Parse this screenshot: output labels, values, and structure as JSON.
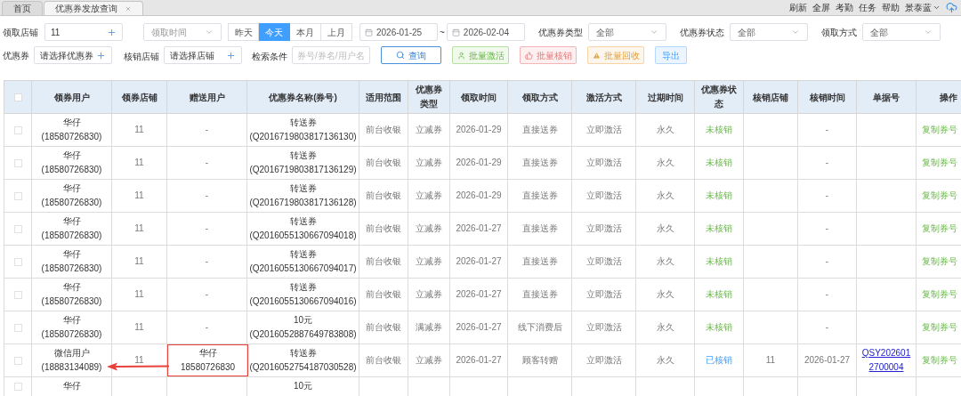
{
  "tabs": [
    {
      "label": "首页",
      "selected": false,
      "closable": false
    },
    {
      "label": "优惠券发放查询",
      "selected": true,
      "closable": true
    }
  ],
  "top_links": [
    "刷新",
    "全屏",
    "考勤",
    "任务",
    "帮助"
  ],
  "user_menu": "景泰蓝",
  "filters": {
    "store": {
      "label": "领取店铺",
      "value": "11"
    },
    "time_select": {
      "placeholder": "领取时间"
    },
    "quick_dates": [
      {
        "label": "昨天",
        "selected": false
      },
      {
        "label": "今天",
        "selected": true
      },
      {
        "label": "本月",
        "selected": false
      },
      {
        "label": "上月",
        "selected": false
      }
    ],
    "date_from": "2026-01-25",
    "date_sep": "~",
    "date_to": "2026-02-04",
    "selects": [
      {
        "label": "优惠券类型",
        "value": "全部"
      },
      {
        "label": "优惠券状态",
        "value": "全部"
      },
      {
        "label": "领取方式",
        "value": "全部"
      }
    ],
    "coupon": {
      "label": "优惠券",
      "placeholder": "请选择优惠券"
    },
    "verify_store": {
      "label": "核销店铺",
      "placeholder": "请选择店铺"
    },
    "search": {
      "label": "检索条件",
      "placeholder": "券号/券名/用户名"
    },
    "buttons": [
      {
        "label": "查询",
        "kind": "search"
      },
      {
        "label": "批量激活",
        "kind": "activate"
      },
      {
        "label": "批量核销",
        "kind": "verify"
      },
      {
        "label": "批量回收",
        "kind": "recycle"
      },
      {
        "label": "导出",
        "kind": "export"
      }
    ]
  },
  "table": {
    "all_checked": false,
    "columns": [
      "领券用户",
      "领券店铺",
      "赠送用户",
      "优惠券名称(券号)",
      "适用范围",
      "优惠券类型",
      "领取时间",
      "领取方式",
      "激活方式",
      "过期时间",
      "优惠券状态",
      "核销店铺",
      "核销时间",
      "单据号",
      "操作"
    ],
    "rows": [
      {
        "checked": false,
        "user": "华仔\n(18580726830)",
        "store": "11",
        "gift_user": "-",
        "gift_highlighted": false,
        "coupon": "转送券\n(Q2016719803817136130)",
        "scope": "前台收银",
        "type": "立减券",
        "time": "2026-01-29",
        "method": "直接送券",
        "activation": "立即激活",
        "expire": "永久",
        "status": "未核销",
        "verified": false,
        "verify_store": "",
        "verify_time": "-",
        "receipt": "",
        "action": "复制券号"
      },
      {
        "checked": false,
        "user": "华仔\n(18580726830)",
        "store": "11",
        "gift_user": "-",
        "gift_highlighted": false,
        "coupon": "转送券\n(Q2016719803817136129)",
        "scope": "前台收银",
        "type": "立减券",
        "time": "2026-01-29",
        "method": "直接送券",
        "activation": "立即激活",
        "expire": "永久",
        "status": "未核销",
        "verified": false,
        "verify_store": "",
        "verify_time": "-",
        "receipt": "",
        "action": "复制券号"
      },
      {
        "checked": false,
        "user": "华仔\n(18580726830)",
        "store": "11",
        "gift_user": "-",
        "gift_highlighted": false,
        "coupon": "转送券\n(Q2016719803817136128)",
        "scope": "前台收银",
        "type": "立减券",
        "time": "2026-01-29",
        "method": "直接送券",
        "activation": "立即激活",
        "expire": "永久",
        "status": "未核销",
        "verified": false,
        "verify_store": "",
        "verify_time": "-",
        "receipt": "",
        "action": "复制券号"
      },
      {
        "checked": false,
        "user": "华仔\n(18580726830)",
        "store": "11",
        "gift_user": "-",
        "gift_highlighted": false,
        "coupon": "转送券\n(Q2016055130667094018)",
        "scope": "前台收银",
        "type": "立减券",
        "time": "2026-01-27",
        "method": "直接送券",
        "activation": "立即激活",
        "expire": "永久",
        "status": "未核销",
        "verified": false,
        "verify_store": "",
        "verify_time": "-",
        "receipt": "",
        "action": "复制券号"
      },
      {
        "checked": false,
        "user": "华仔\n(18580726830)",
        "store": "11",
        "gift_user": "-",
        "gift_highlighted": false,
        "coupon": "转送券\n(Q2016055130667094017)",
        "scope": "前台收银",
        "type": "立减券",
        "time": "2026-01-27",
        "method": "直接送券",
        "activation": "立即激活",
        "expire": "永久",
        "status": "未核销",
        "verified": false,
        "verify_store": "",
        "verify_time": "-",
        "receipt": "",
        "action": "复制券号"
      },
      {
        "checked": false,
        "user": "华仔\n(18580726830)",
        "store": "11",
        "gift_user": "-",
        "gift_highlighted": false,
        "coupon": "转送券\n(Q2016055130667094016)",
        "scope": "前台收银",
        "type": "立减券",
        "time": "2026-01-27",
        "method": "直接送券",
        "activation": "立即激活",
        "expire": "永久",
        "status": "未核销",
        "verified": false,
        "verify_store": "",
        "verify_time": "-",
        "receipt": "",
        "action": "复制券号"
      },
      {
        "checked": false,
        "user": "华仔\n(18580726830)",
        "store": "11",
        "gift_user": "-",
        "gift_highlighted": false,
        "coupon": "10元\n(Q2016052887649783808)",
        "scope": "前台收银",
        "type": "满减券",
        "time": "2026-01-27",
        "method": "线下消费后",
        "activation": "立即激活",
        "expire": "永久",
        "status": "未核销",
        "verified": false,
        "verify_store": "",
        "verify_time": "-",
        "receipt": "",
        "action": "复制券号"
      },
      {
        "checked": false,
        "user": "微信用户\n(18883134089)",
        "store": "11",
        "gift_user": "华仔\n18580726830",
        "gift_highlighted": true,
        "coupon": "转送券\n(Q2016052754187030528)",
        "scope": "前台收银",
        "type": "立减券",
        "time": "2026-01-27",
        "method": "顾客转赠",
        "activation": "立即激活",
        "expire": "永久",
        "status": "已核销",
        "verified": true,
        "verify_store": "11",
        "verify_time": "2026-01-27",
        "receipt": "QSY202601\n2700004",
        "action": "复制券号"
      },
      {
        "checked": false,
        "user": "华仔",
        "store": "",
        "gift_user": "",
        "coupon": "10元",
        "scope": "",
        "type": "",
        "time": "",
        "method": "",
        "activation": "",
        "expire": "",
        "status": "",
        "verify_store": "",
        "verify_time": "",
        "receipt": "",
        "action": ""
      }
    ]
  }
}
